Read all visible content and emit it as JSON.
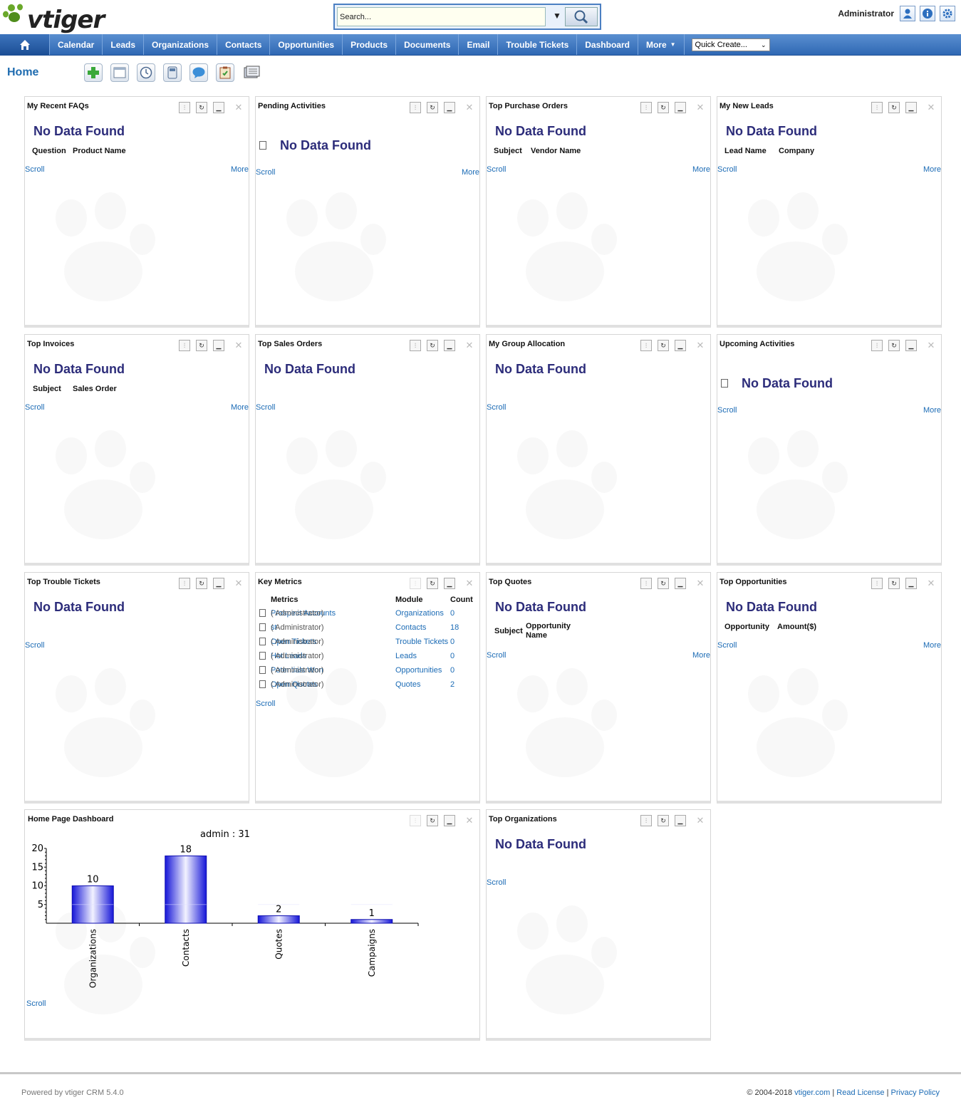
{
  "app": {
    "logo_text": "vtiger",
    "user": "Administrator"
  },
  "search": {
    "placeholder": "Search...",
    "value": "Search..."
  },
  "nav": {
    "items": [
      "Calendar",
      "Leads",
      "Organizations",
      "Contacts",
      "Opportunities",
      "Products",
      "Documents",
      "Email",
      "Trouble Tickets",
      "Dashboard",
      "More"
    ],
    "quick_create": "Quick Create..."
  },
  "page": {
    "title": "Home"
  },
  "common": {
    "no_data": "No Data Found",
    "scroll": "Scroll",
    "more": "More"
  },
  "widgets": {
    "faqs": {
      "title": "My Recent FAQs",
      "col1": "Question",
      "col2": "Product Name"
    },
    "pending": {
      "title": "Pending Activities"
    },
    "purchase_orders": {
      "title": "Top Purchase Orders",
      "col1": "Subject",
      "col2": "Vendor Name"
    },
    "new_leads": {
      "title": "My New Leads",
      "col1": "Lead Name",
      "col2": "Company"
    },
    "invoices": {
      "title": "Top Invoices",
      "col1": "Subject",
      "col2": "Sales Order"
    },
    "sales_orders": {
      "title": "Top Sales Orders"
    },
    "group_allocation": {
      "title": "My Group Allocation"
    },
    "upcoming": {
      "title": "Upcoming Activities"
    },
    "trouble_tickets": {
      "title": "Top Trouble Tickets"
    },
    "key_metrics": {
      "title": "Key Metrics",
      "headers": {
        "metrics": "Metrics",
        "module": "Module",
        "count": "Count"
      },
      "rows": [
        {
          "name": "Prospect Accounts",
          "owner": "( Administrator)",
          "module": "Organizations",
          "count": "0"
        },
        {
          "name": "st",
          "owner": "( Administrator)",
          "module": "Contacts",
          "count": "18"
        },
        {
          "name": "Open Tickets",
          "owner": "( Administrator)",
          "module": "Trouble Tickets",
          "count": "0"
        },
        {
          "name": "Hot Leads",
          "owner": "( Administrator)",
          "module": "Leads",
          "count": "0"
        },
        {
          "name": "Potentials Won",
          "owner": "( Administrator)",
          "module": "Opportunities",
          "count": "0"
        },
        {
          "name": "Open Quotes",
          "owner": "( Administrator)",
          "module": "Quotes",
          "count": "2"
        }
      ]
    },
    "quotes": {
      "title": "Top Quotes",
      "col1": "Subject",
      "col2": "Opportunity Name"
    },
    "opportunities": {
      "title": "Top Opportunities",
      "col1": "Opportunity",
      "col2": "Amount($)"
    },
    "dashboard": {
      "title": "Home Page Dashboard"
    },
    "organizations": {
      "title": "Top Organizations"
    }
  },
  "chart_data": {
    "type": "bar",
    "title": "admin : 31",
    "categories": [
      "Organizations",
      "Contacts",
      "Quotes",
      "Campaigns"
    ],
    "values": [
      10,
      18,
      2,
      1
    ],
    "ylim": [
      0,
      20
    ],
    "yticks": [
      5,
      10,
      15,
      20
    ],
    "bar_color": "#2020e0"
  },
  "footer": {
    "powered": "Powered by vtiger CRM 5.4.0",
    "copyright": "© 2004-2018",
    "site": "vtiger.com",
    "sep": "|",
    "license": "Read License",
    "privacy": "Privacy Policy"
  }
}
